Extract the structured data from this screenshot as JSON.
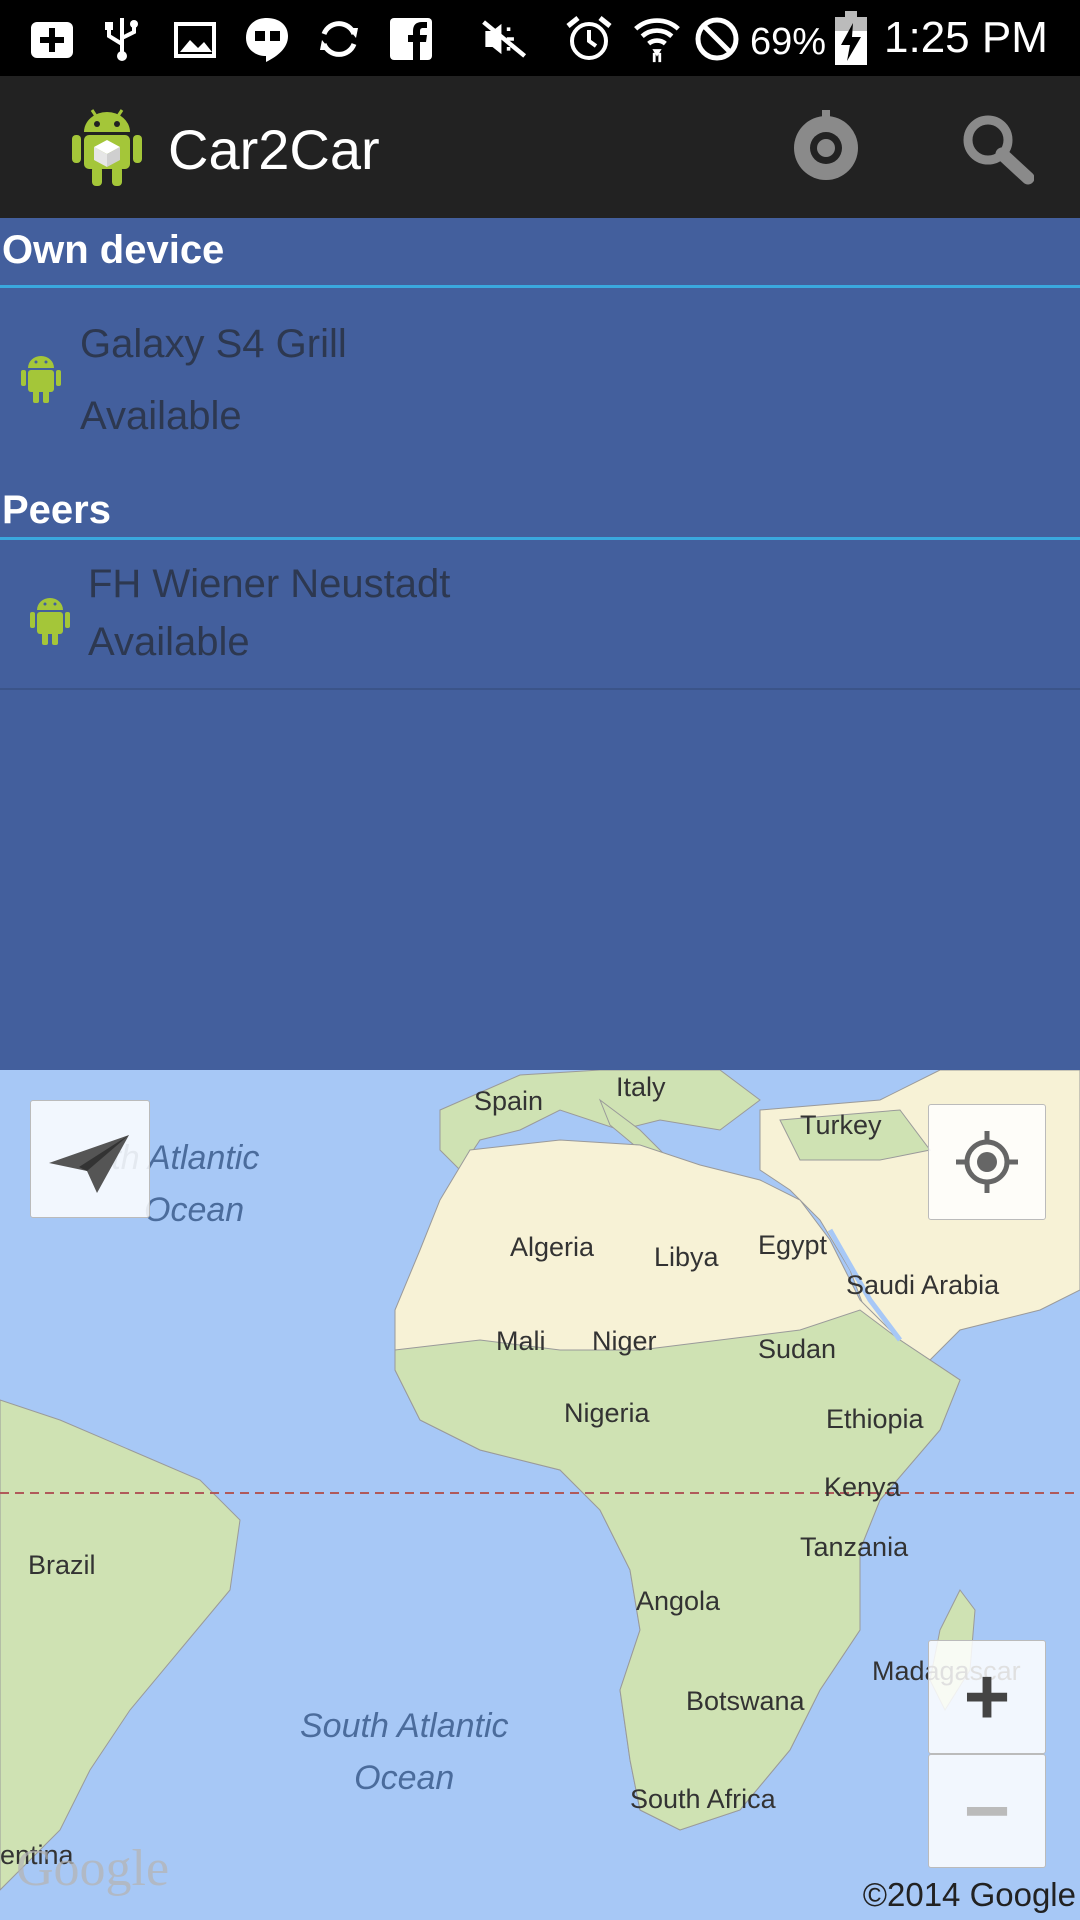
{
  "status_bar": {
    "battery": "69%",
    "time": "1:25 PM",
    "icons": [
      "add-box-icon",
      "usb-icon",
      "image-icon",
      "hangouts-icon",
      "sync-icon",
      "facebook-icon",
      "mute-icon",
      "alarm-icon",
      "wifi-icon",
      "no-icon",
      "battery-charging-icon"
    ]
  },
  "action_bar": {
    "title": "Car2Car",
    "app_icon": "android-app-icon",
    "actions": [
      "settings-icon",
      "search-icon"
    ]
  },
  "own_device": {
    "header": "Own device",
    "device": {
      "name": "Galaxy S4 Grill",
      "status": "Available",
      "icon": "android-icon"
    }
  },
  "peers": {
    "header": "Peers",
    "items": [
      {
        "name": "FH Wiener Neustadt",
        "status": "Available",
        "icon": "android-icon"
      }
    ]
  },
  "map": {
    "labels": {
      "spain": "Spain",
      "italy": "Italy",
      "turkey": "Turkey",
      "algeria": "Algeria",
      "libya": "Libya",
      "egypt": "Egypt",
      "saudi_arabia": "Saudi Arabia",
      "mali": "Mali",
      "niger": "Niger",
      "sudan": "Sudan",
      "nigeria": "Nigeria",
      "ethiopia": "Ethiopia",
      "kenya": "Kenya",
      "tanzania": "Tanzania",
      "brazil": "Brazil",
      "angola": "Angola",
      "madagascar": "Madagascar",
      "botswana": "Botswana",
      "south_africa": "South Africa",
      "argentina_partial": "entina"
    },
    "oceans": {
      "north_atlantic_line1": "rth Atlantic",
      "north_atlantic_line2": "Ocean",
      "south_atlantic_line1": "South Atlantic",
      "south_atlantic_line2": "Ocean"
    },
    "zoom_in": "+",
    "zoom_out": "−",
    "logo": "Google",
    "copyright": "©2014 Google",
    "colors": {
      "water": "#a7c8f6",
      "land_green": "#cfe2b3",
      "land_desert": "#f7f2d6",
      "panel": "#435f9d",
      "divider": "#3aa8de"
    }
  }
}
